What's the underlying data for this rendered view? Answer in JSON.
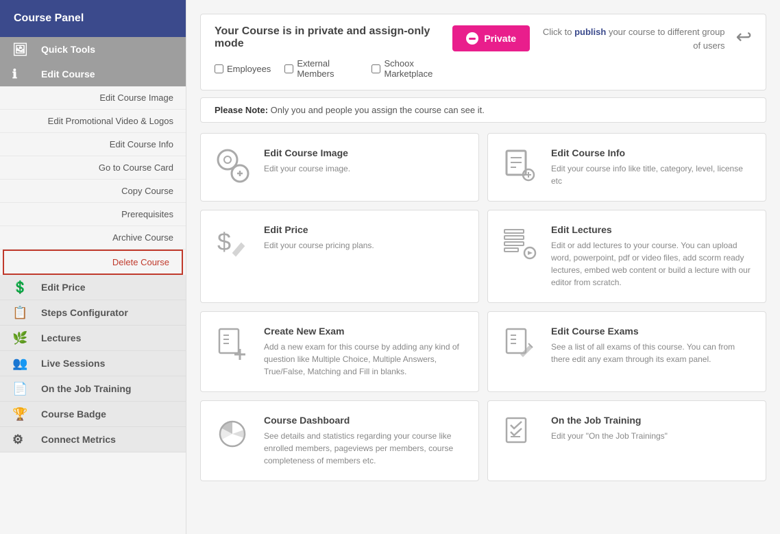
{
  "sidebar": {
    "title": "Course Panel",
    "sections": [
      {
        "id": "quick-tools",
        "label": "Quick Tools",
        "icon": "🖼"
      },
      {
        "id": "edit-course",
        "label": "Edit Course",
        "icon": "ℹ"
      }
    ],
    "links": [
      {
        "id": "edit-course-image",
        "label": "Edit Course Image"
      },
      {
        "id": "edit-promo",
        "label": "Edit Promotional Video & Logos"
      },
      {
        "id": "edit-course-info",
        "label": "Edit Course Info"
      },
      {
        "id": "go-to-course-card",
        "label": "Go to Course Card"
      },
      {
        "id": "copy-course",
        "label": "Copy Course"
      },
      {
        "id": "prerequisites",
        "label": "Prerequisites"
      },
      {
        "id": "archive-course",
        "label": "Archive Course"
      },
      {
        "id": "delete-course",
        "label": "Delete Course",
        "highlight": true
      }
    ],
    "nav_items": [
      {
        "id": "edit-price",
        "label": "Edit Price",
        "icon": "💲"
      },
      {
        "id": "steps-configurator",
        "label": "Steps Configurator",
        "icon": "📋"
      },
      {
        "id": "lectures",
        "label": "Lectures",
        "icon": "🌿"
      },
      {
        "id": "live-sessions",
        "label": "Live Sessions",
        "icon": "👥"
      },
      {
        "id": "on-job-training",
        "label": "On the Job Training",
        "icon": "📄"
      },
      {
        "id": "course-badge",
        "label": "Course Badge",
        "icon": "🏆"
      },
      {
        "id": "connect-metrics",
        "label": "Connect Metrics",
        "icon": "⚙"
      }
    ]
  },
  "topbar": {
    "heading": "Your Course is in private and assign-only mode",
    "private_btn": "Private",
    "publish_text_before": "Click to ",
    "publish_link": "publish",
    "publish_text_after": " your course\nto different group of users",
    "checkboxes": [
      {
        "id": "employees",
        "label": "Employees"
      },
      {
        "id": "external-members",
        "label": "External Members"
      },
      {
        "id": "schoox-marketplace",
        "label": "Schoox Marketplace"
      }
    ]
  },
  "note": {
    "bold": "Please Note:",
    "text": " Only you and people you assign the course can see it."
  },
  "cards": [
    {
      "id": "edit-course-image",
      "title": "Edit Course Image",
      "desc": "Edit your course image.",
      "icon": "⚙🖼"
    },
    {
      "id": "edit-course-info",
      "title": "Edit Course Info",
      "desc": "Edit your course info like title, category, level, license etc",
      "icon": "📚⚙"
    },
    {
      "id": "edit-price",
      "title": "Edit Price",
      "desc": "Edit your course pricing plans.",
      "icon": "💲📋"
    },
    {
      "id": "edit-lectures",
      "title": "Edit Lectures",
      "desc": "Edit or add lectures to your course. You can upload word, powerpoint, pdf or video files, add scorm ready lectures, embed web content or build a lecture with our editor from scratch.",
      "icon": "📄⚙"
    },
    {
      "id": "create-new-exam",
      "title": "Create New Exam",
      "desc": "Add a new exam for this course by adding any kind of question like Multiple Choice, Multiple Answers, True/False, Matching and Fill in blanks.",
      "icon": "📝➕"
    },
    {
      "id": "edit-course-exams",
      "title": "Edit Course Exams",
      "desc": "See a list of all exams of this course. You can from there edit any exam through its exam panel.",
      "icon": "📝⚙"
    },
    {
      "id": "course-dashboard",
      "title": "Course Dashboard",
      "desc": "See details and statistics regarding your course like enrolled members, pageviews per members, course completeness of members etc.",
      "icon": "📊"
    },
    {
      "id": "on-the-job-training",
      "title": "On the Job Training",
      "desc": "Edit your \"On the Job Trainings\"",
      "icon": "✅📋"
    }
  ]
}
